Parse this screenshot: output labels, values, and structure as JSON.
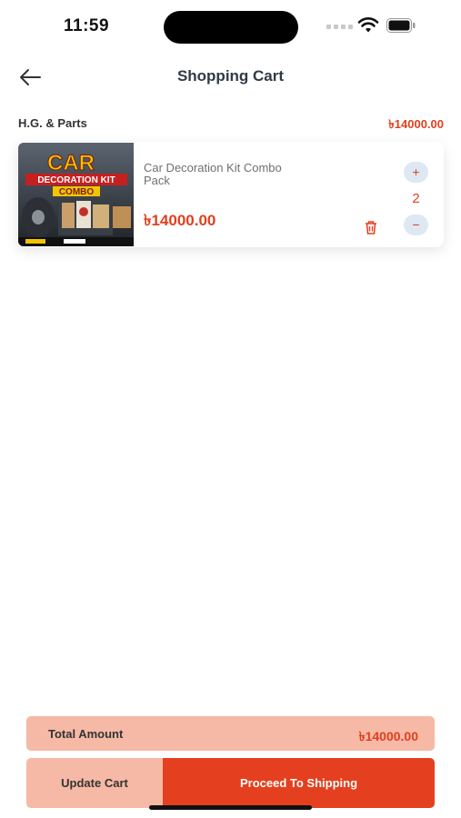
{
  "status_bar": {
    "time": "11:59"
  },
  "header": {
    "title": "Shopping Cart"
  },
  "seller": {
    "name": "H.G. & Parts",
    "subtotal": "৳14000.00"
  },
  "cart_items": [
    {
      "name": "Car Decoration Kit Combo Pack",
      "price": "৳14000.00",
      "quantity": "2",
      "image_text": {
        "line1": "CAR",
        "line2": "DECORATION KIT",
        "line3": "COMBO"
      }
    }
  ],
  "summary": {
    "total_label": "Total Amount",
    "total_value": "৳14000.00"
  },
  "actions": {
    "update_label": "Update Cart",
    "proceed_label": "Proceed To Shipping"
  },
  "colors": {
    "accent": "#e4401f",
    "accent_light": "#f6b9a5",
    "qty_button_bg": "#dde8f3"
  }
}
